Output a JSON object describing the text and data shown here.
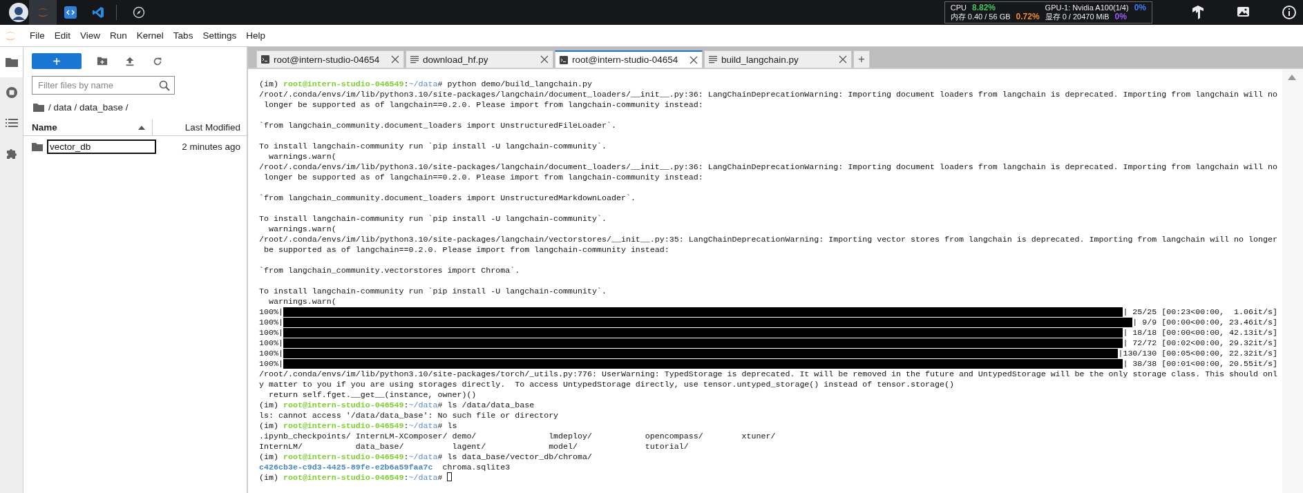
{
  "topbar": {
    "launchers": [
      {
        "kind": "jupyter",
        "selected": true
      },
      {
        "kind": "code",
        "selected": false
      },
      {
        "kind": "vscode",
        "selected": false
      },
      {
        "kind": "compass",
        "selected": false
      }
    ],
    "stats": [
      {
        "label": "CPU",
        "value": "8.82%",
        "color": "#3fc35a"
      },
      {
        "label": "GPU-1: Nvidia A100(1/4)",
        "value": "0%",
        "color": "#3d7cf0"
      },
      {
        "label": "内存 0.40 / 56 GB",
        "value": "0.72%",
        "color": "#f08a2c"
      },
      {
        "label": "显存 0 / 20470 MiB",
        "value": "0%",
        "color": "#9a5cf0"
      }
    ]
  },
  "menu": [
    "File",
    "Edit",
    "View",
    "Run",
    "Kernel",
    "Tabs",
    "Settings",
    "Help"
  ],
  "sidebar_tabs": [
    {
      "kind": "folder",
      "selected": true
    },
    {
      "kind": "running",
      "selected": false
    },
    {
      "kind": "toc",
      "selected": false
    },
    {
      "kind": "extensions",
      "selected": false
    }
  ],
  "file_browser": {
    "new_label": "+",
    "filter": {
      "placeholder": "Filter files by name"
    },
    "breadcrumb": "/ data / data_base /",
    "columns": [
      {
        "label": "Name",
        "sorted": true
      },
      {
        "label": "Last Modified",
        "sorted": false
      }
    ],
    "files": [
      {
        "name": "vector_db",
        "kind": "folder",
        "modified": "2 minutes ago",
        "renaming": true
      }
    ]
  },
  "tabs": [
    {
      "label": "root@intern-studio-04654",
      "kind": "terminal",
      "selected": false
    },
    {
      "label": "download_hf.py",
      "kind": "file",
      "selected": false
    },
    {
      "label": "root@intern-studio-04654",
      "kind": "terminal",
      "selected": true
    },
    {
      "label": "build_langchain.py",
      "kind": "file",
      "selected": false
    }
  ],
  "add_tab": "+",
  "terminal": [
    {
      "kind": "prompt",
      "env": "(im)",
      "user": "root@intern-studio-046549",
      "separator": ":",
      "path": "~/data",
      "symbol": "#",
      "command": "python demo/build_langchain.py"
    },
    {
      "kind": "text",
      "text": "/root/.conda/envs/im/lib/python3.10/site-packages/langchain/document_loaders/__init__.py:36: LangChainDeprecationWarning: Importing document loaders from langchain is deprecated. Importing from langchain will no"
    },
    {
      "kind": "text",
      "text": " longer be supported as of langchain==0.2.0. Please import from langchain-community instead:"
    },
    {
      "kind": "blank"
    },
    {
      "kind": "text",
      "text": "`from langchain_community.document_loaders import UnstructuredFileLoader`."
    },
    {
      "kind": "blank"
    },
    {
      "kind": "text",
      "text": "To install langchain-community run `pip install -U langchain-community`."
    },
    {
      "kind": "text",
      "text": "  warnings.warn("
    },
    {
      "kind": "text",
      "text": "/root/.conda/envs/im/lib/python3.10/site-packages/langchain/document_loaders/__init__.py:36: LangChainDeprecationWarning: Importing document loaders from langchain is deprecated. Importing from langchain will no"
    },
    {
      "kind": "text",
      "text": " longer be supported as of langchain==0.2.0. Please import from langchain-community instead:"
    },
    {
      "kind": "blank"
    },
    {
      "kind": "text",
      "text": "`from langchain_community.document_loaders import UnstructuredMarkdownLoader`."
    },
    {
      "kind": "blank"
    },
    {
      "kind": "text",
      "text": "To install langchain-community run `pip install -U langchain-community`."
    },
    {
      "kind": "text",
      "text": "  warnings.warn("
    },
    {
      "kind": "text",
      "text": "/root/.conda/envs/im/lib/python3.10/site-packages/langchain/vectorstores/__init__.py:35: LangChainDeprecationWarning: Importing vector stores from langchain is deprecated. Importing from langchain will no longer"
    },
    {
      "kind": "text",
      "text": " be supported as of langchain==0.2.0. Please import from langchain-community instead:"
    },
    {
      "kind": "blank"
    },
    {
      "kind": "text",
      "text": "`from langchain_community.vectorstores import Chroma`."
    },
    {
      "kind": "blank"
    },
    {
      "kind": "text",
      "text": "To install langchain-community run `pip install -U langchain-community`."
    },
    {
      "kind": "text",
      "text": "  warnings.warn("
    },
    {
      "kind": "progress",
      "label": "100%|",
      "level": 1,
      "stats": "| 25/25 [00:23<00:00,  1.06it/s]"
    },
    {
      "kind": "progress",
      "label": "100%|",
      "level": 1,
      "stats": "| 9/9 [00:00<00:00, 23.46it/s]"
    },
    {
      "kind": "progress",
      "label": "100%|",
      "level": 1,
      "stats": "| 18/18 [00:00<00:00, 42.13it/s]"
    },
    {
      "kind": "progress",
      "label": "100%|",
      "level": 1,
      "stats": "| 72/72 [00:02<00:00, 29.32it/s]"
    },
    {
      "kind": "progress",
      "label": "100%|",
      "level": 1,
      "stats": "|130/130 [00:05<00:00, 22.32it/s]"
    },
    {
      "kind": "progress",
      "label": "100%|",
      "level": 1,
      "stats": "| 38/38 [00:01<00:00, 20.55it/s]"
    },
    {
      "kind": "text",
      "text": "/root/.conda/envs/im/lib/python3.10/site-packages/torch/_utils.py:776: UserWarning: TypedStorage is deprecated. It will be removed in the future and UntypedStorage will be the only storage class. This should onl"
    },
    {
      "kind": "text",
      "text": "y matter to you if you are using storages directly.  To access UntypedStorage directly, use tensor.untyped_storage() instead of tensor.storage()"
    },
    {
      "kind": "text",
      "text": "  return self.fget.__get__(instance, owner)()"
    },
    {
      "kind": "prompt",
      "env": "(im)",
      "user": "root@intern-studio-046549",
      "separator": ":",
      "path": "~/data",
      "symbol": "#",
      "command": "ls /data/data_base"
    },
    {
      "kind": "text",
      "text": "ls: cannot access '/data/data_base': No such file or directory"
    },
    {
      "kind": "prompt",
      "env": "(im)",
      "user": "root@intern-studio-046549",
      "separator": ":",
      "path": "~/data",
      "symbol": "#",
      "command": "ls"
    },
    {
      "kind": "text",
      "text": ".ipynb_checkpoints/ InternLM-XComposer/ demo/               lmdeploy/           opencompass/        xtuner/"
    },
    {
      "kind": "text",
      "text": "InternLM/           data_base/          lagent/             model/              tutorial/"
    },
    {
      "kind": "prompt",
      "env": "(im)",
      "user": "root@intern-studio-046549",
      "separator": ":",
      "path": "~/data",
      "symbol": "#",
      "command": "ls data_base/vector_db/chroma/"
    },
    {
      "kind": "listing",
      "entries": [
        {
          "kind": "dir",
          "name": "c426cb3e-c9d3-4425-89fe-e2b6a59faa7c"
        },
        {
          "kind": "file",
          "name": "chroma.sqlite3"
        }
      ]
    },
    {
      "kind": "prompt",
      "env": "(im)",
      "user": "root@intern-studio-046549",
      "separator": ":",
      "path": "~/data",
      "symbol": "#",
      "cursor": true
    }
  ]
}
